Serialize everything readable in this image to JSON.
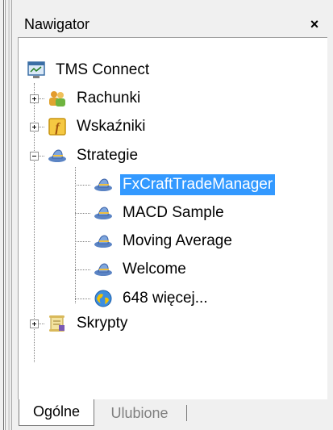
{
  "panel": {
    "title": "Nawigator",
    "close_label": "×"
  },
  "tree": {
    "root": {
      "label": "TMS Connect",
      "icon": "terminal-icon"
    },
    "items": [
      {
        "label": "Rachunki",
        "icon": "accounts-icon",
        "expander": "plus"
      },
      {
        "label": "Wskaźniki",
        "icon": "indicators-icon",
        "expander": "plus"
      },
      {
        "label": "Strategie",
        "icon": "expert-hat-icon",
        "expander": "minus",
        "children": [
          {
            "label": "FxCraftTradeManager",
            "icon": "expert-hat-icon",
            "selected": true
          },
          {
            "label": "MACD Sample",
            "icon": "expert-hat-icon"
          },
          {
            "label": "Moving Average",
            "icon": "expert-hat-icon"
          },
          {
            "label": "Welcome",
            "icon": "expert-hat-icon"
          },
          {
            "label": "648 więcej...",
            "icon": "globe-icon"
          }
        ]
      },
      {
        "label": "Skrypty",
        "icon": "scripts-icon",
        "expander": "plus"
      }
    ]
  },
  "tabs": [
    {
      "label": "Ogólne",
      "active": true
    },
    {
      "label": "Ulubione",
      "active": false
    }
  ],
  "colors": {
    "selection": "#3399ff",
    "background": "#f0f0f0",
    "panel": "#ffffff"
  }
}
